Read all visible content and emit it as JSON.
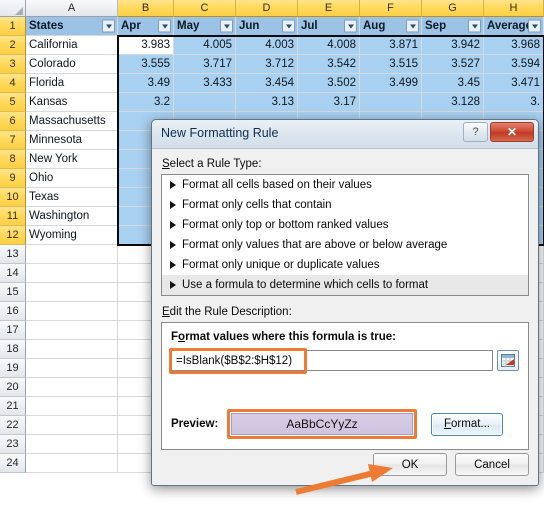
{
  "spreadsheet": {
    "column_headers": [
      "A",
      "B",
      "C",
      "D",
      "E",
      "F",
      "G",
      "H"
    ],
    "selected_columns": [
      "B",
      "C",
      "D",
      "E",
      "F",
      "G",
      "H"
    ],
    "row_headers": [
      "1",
      "2",
      "3",
      "4",
      "5",
      "6",
      "7",
      "8",
      "9",
      "10",
      "11",
      "12",
      "13",
      "14",
      "15",
      "16",
      "17",
      "18",
      "19",
      "20",
      "21",
      "22",
      "23",
      "24"
    ],
    "selected_rows": [
      "1",
      "2",
      "3",
      "4",
      "5",
      "6",
      "7",
      "8",
      "9",
      "10",
      "11",
      "12"
    ],
    "table_headers": [
      "States",
      "Apr",
      "May",
      "Jun",
      "Jul",
      "Aug",
      "Sep",
      "Average"
    ],
    "filter_icon": "filter-dropdown-icon",
    "selection_range": "B2:H12",
    "rows": [
      {
        "state": "California",
        "values": [
          "3.983",
          "4.005",
          "4.003",
          "4.008",
          "3.871",
          "3.942",
          "3.968"
        ]
      },
      {
        "state": "Colorado",
        "values": [
          "3.555",
          "3.717",
          "3.712",
          "3.542",
          "3.515",
          "3.527",
          "3.594"
        ]
      },
      {
        "state": "Florida",
        "values": [
          "3.49",
          "3.433",
          "3.454",
          "3.502",
          "3.499",
          "3.45",
          "3.471"
        ]
      },
      {
        "state": "Kansas",
        "values": [
          "3.2",
          "",
          "3.13",
          "3.17",
          "",
          "3.128",
          "3."
        ]
      },
      {
        "state": "Massachusetts",
        "values": [
          "",
          "",
          "",
          "",
          "",
          "",
          ""
        ]
      },
      {
        "state": "Minnesota",
        "values": [
          "",
          "",
          "",
          "",
          "",
          "",
          ""
        ]
      },
      {
        "state": "New York",
        "values": [
          "",
          "",
          "",
          "",
          "",
          "",
          ""
        ]
      },
      {
        "state": "Ohio",
        "values": [
          "",
          "",
          "",
          "",
          "",
          "",
          ""
        ]
      },
      {
        "state": "Texas",
        "values": [
          "",
          "",
          "",
          "",
          "",
          "",
          ""
        ]
      },
      {
        "state": "Washington",
        "values": [
          "",
          "",
          "",
          "",
          "",
          "",
          ""
        ]
      },
      {
        "state": "Wyoming",
        "values": [
          "",
          "",
          "",
          "",
          "",
          "",
          ""
        ]
      }
    ],
    "empty_row_count": 12
  },
  "dialog": {
    "title": "New Formatting Rule",
    "help_glyph": "?",
    "close_glyph": "✕",
    "rule_type_label": "Select a Rule Type:",
    "rule_types": [
      "Format all cells based on their values",
      "Format only cells that contain",
      "Format only top or bottom ranked values",
      "Format only values that are above or below average",
      "Format only unique or duplicate values",
      "Use a formula to determine which cells to format"
    ],
    "selected_rule_index": 5,
    "description_label": "Edit the Rule Description:",
    "formula_prompt": "Format values where this formula is true:",
    "formula_value": "=IsBlank($B$2:$H$12)",
    "range_picker_icon": "range-select-icon",
    "preview_label": "Preview:",
    "preview_text": "AaBbCcYyZz",
    "preview_fill_color": "#cfc3e0",
    "format_button": "Format...",
    "ok_button": "OK",
    "cancel_button": "Cancel"
  },
  "annotations": {
    "highlight_color": "#ee7b33",
    "arrow_target": "ok-button"
  }
}
